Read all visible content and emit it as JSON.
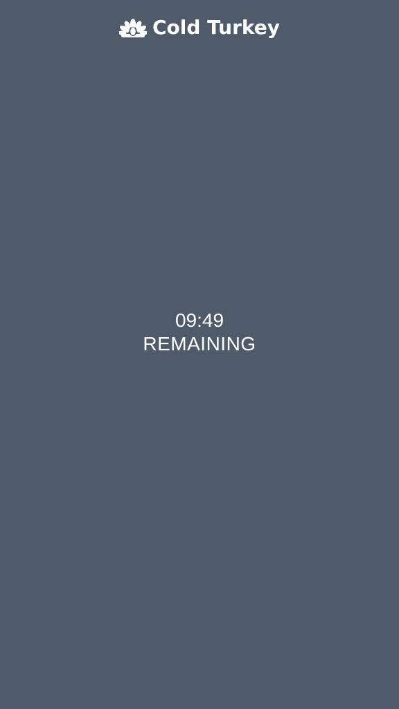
{
  "header": {
    "logo_icon": "turkey-icon",
    "brand": "Cold Turkey"
  },
  "timer": {
    "time": "09:49",
    "label": "REMAINING"
  },
  "colors": {
    "background": "#4f5b6a",
    "text": "#ffffff"
  }
}
